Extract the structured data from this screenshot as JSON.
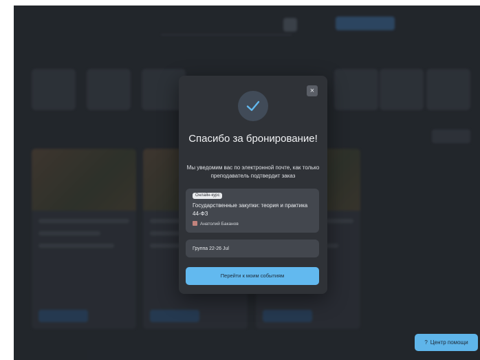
{
  "modal": {
    "title": "Спасибо за бронирование!",
    "subtitle": "Мы уведомим вас по электронной почте, как только преподаватель подтвердит заказ",
    "close_icon": "×",
    "course": {
      "badge": "Онлайн-курс",
      "title": "Государственные закупки: теория и практика 44-ФЗ",
      "author": "Анатолий Баканов"
    },
    "group": "Группа 22-26 Jul",
    "primary_button": "Перейти к моим событиям"
  },
  "help": {
    "icon": "?",
    "label": "Центр помощи"
  },
  "colors": {
    "accent": "#62b9ef",
    "modal_bg": "#2f3237",
    "card_bg": "#43474e",
    "check": "#62b9ef"
  }
}
